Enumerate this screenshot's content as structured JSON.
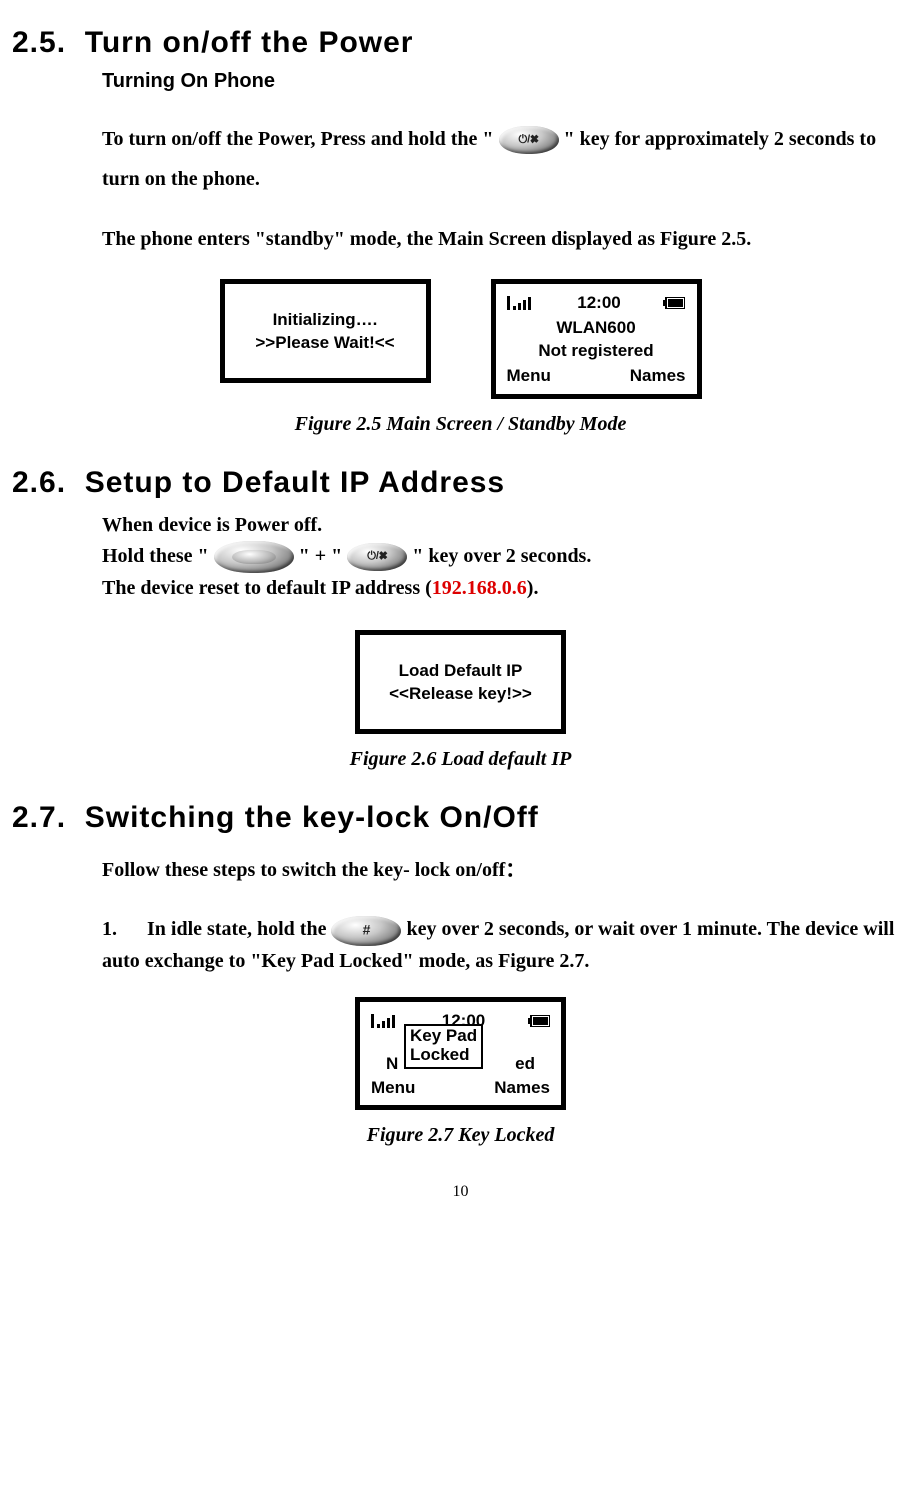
{
  "sec25": {
    "num": "2.5.",
    "title": "Turn on/off the Power",
    "sub": "Turning On Phone",
    "p1a": "To turn on/off the Power, Press and hold the \"",
    "p1b": "\" key for approximately 2 seconds to turn on the phone.",
    "p2": "The phone enters \"standby\" mode, the Main Screen displayed as Figure 2.5.",
    "fig25": {
      "left_line1": "Initializing….",
      "left_line2": ">>Please Wait!<<",
      "right_time": "12:00",
      "right_name": "WLAN600",
      "right_status": "Not registered",
      "soft_left": "Menu",
      "soft_right": "Names",
      "caption": "Figure 2.5   Main Screen / Standby Mode"
    }
  },
  "sec26": {
    "num": "2.6.",
    "title": "Setup to Default IP Address",
    "l1": "When device is Power off.",
    "l2a": "Hold these \"",
    "l2b": "\" + \"",
    "l2c": "\" key over 2 seconds.",
    "l3a": "The device reset to default IP address (",
    "l3ip": "192.168.0.6",
    "l3b": ").",
    "fig26": {
      "line1": "Load Default IP",
      "line2": "<<Release key!>>",
      "caption": "Figure 2.6 Load default IP"
    }
  },
  "sec27": {
    "num": "2.7.",
    "title": "Switching the key-lock On/Off",
    "intro": "Follow these steps to switch the key- lock on/off：",
    "step1_num": "1.",
    "step1a": "In idle state, hold the  ",
    "step1b": "  key over 2 seconds, or wait over 1 minute. The device will auto exchange to \"Key Pad Locked\" mode, as Figure 2.7.",
    "fig27": {
      "time": "12:00",
      "bg_left": "N",
      "bg_right": "ed",
      "popup_l1": "Key Pad",
      "popup_l2": "Locked",
      "soft_left": "Menu",
      "soft_right": "Names",
      "caption": "Figure 2.7 Key Locked"
    }
  },
  "page": "10"
}
